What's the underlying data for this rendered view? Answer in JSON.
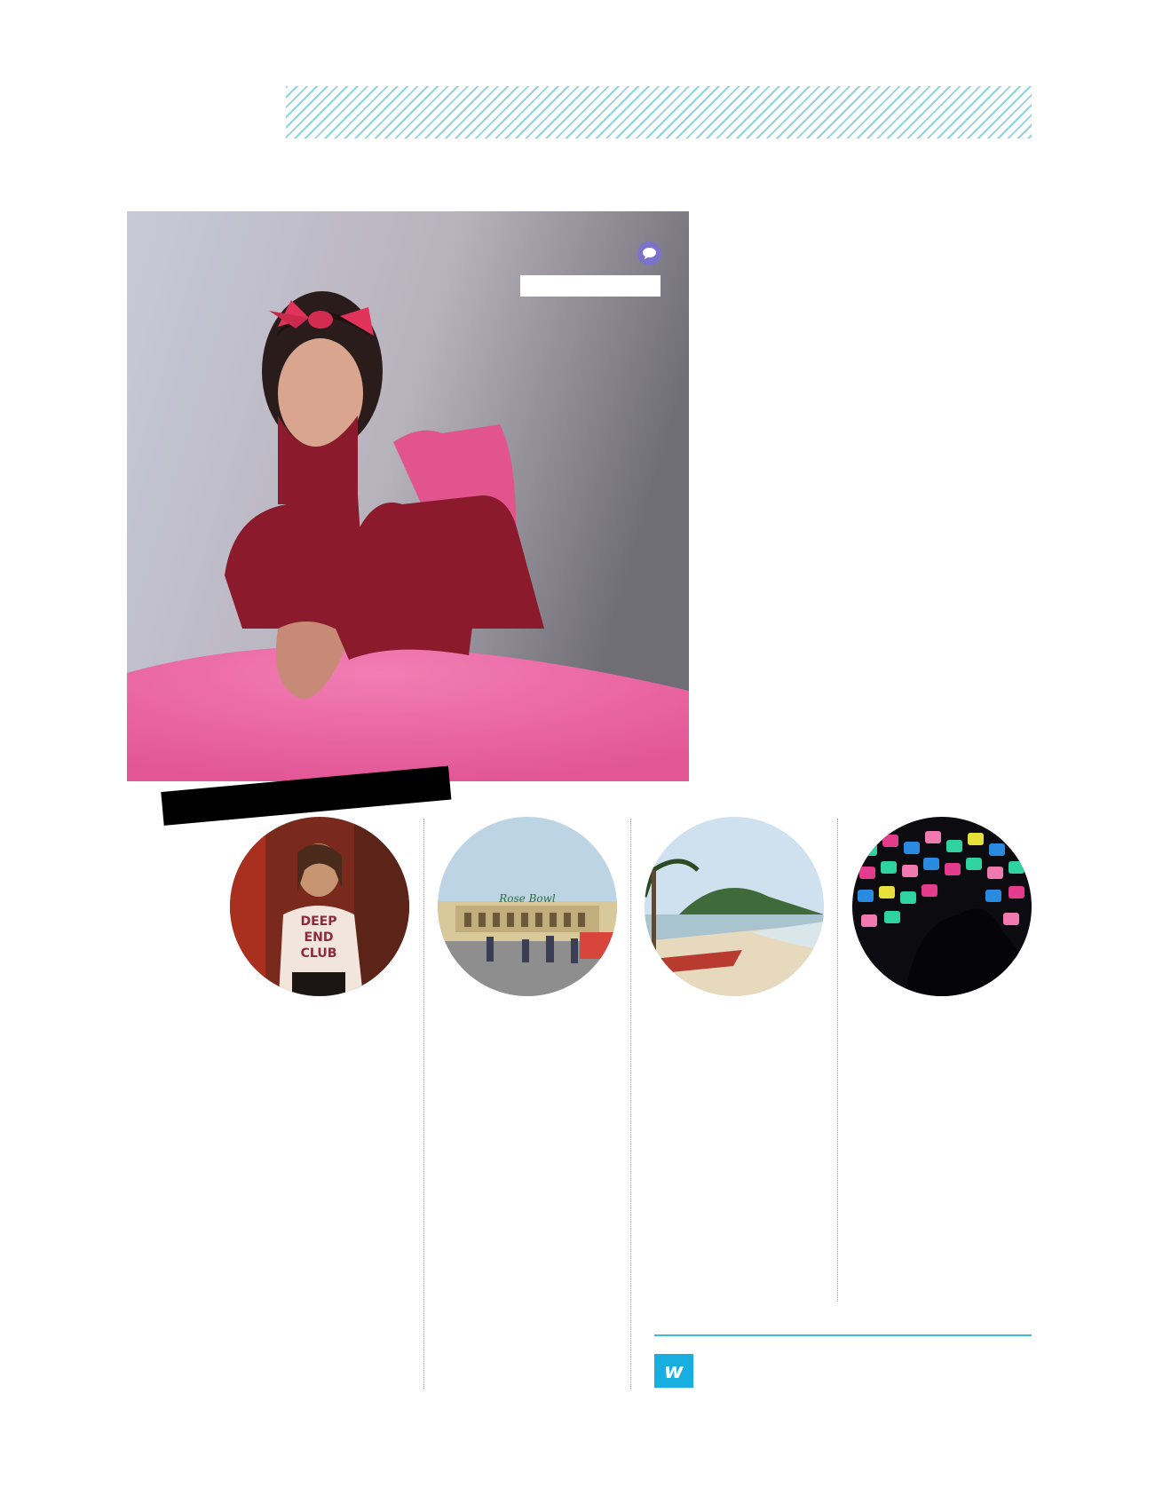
{
  "logo": {
    "letter": "w"
  },
  "colors": {
    "hatch": "#8fd3dd",
    "accent": "#19aee0",
    "rule": "#3cb9e2",
    "comment_icon": "#7b72c9",
    "label_bar": "#000000"
  },
  "icons": {
    "comment": "speech-bubble-icon"
  },
  "photos": {
    "hero": "portrait-woman-red-bow-pink-table",
    "circles": [
      "person-deep-end-club-tshirt",
      "rose-bowl-flea-market",
      "tropical-beach-boats",
      "colorful-glow-figurines"
    ]
  },
  "shirt_text": [
    "DEEP",
    "END",
    "CLUB"
  ],
  "stadium_sign": "Rose Bowl"
}
